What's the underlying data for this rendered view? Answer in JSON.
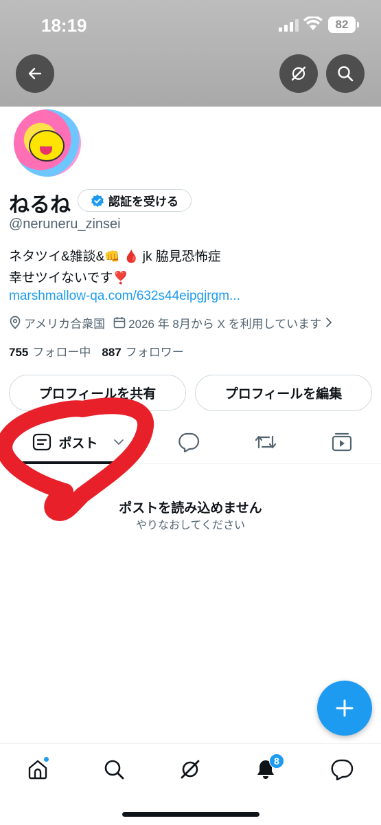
{
  "status_bar": {
    "time": "18:19",
    "battery": "82"
  },
  "profile": {
    "name": "ねるね",
    "verify_label": "認証を受ける",
    "handle": "@neruneru_zinsei",
    "bio_line1_a": "ネタツイ&雑談&",
    "bio_line1_b": "jk 脇見恐怖症",
    "bio_line2": "幸せツイないです",
    "bio_emojis": [
      "👊",
      "🩸",
      "❣️"
    ],
    "link": "marshmallow-qa.com/632s44eipgjrgm...",
    "location": "アメリカ合衆国",
    "joined": "2026 年 8月から X を利用しています",
    "following_count": "755",
    "following_label": "フォロー中",
    "followers_count": "887",
    "followers_label": "フォロワー"
  },
  "actions": {
    "share_label": "プロフィールを共有",
    "edit_label": "プロフィールを編集"
  },
  "tabs": {
    "posts_label": "ポスト"
  },
  "feed": {
    "error_title": "ポストを読み込めません",
    "error_subtitle": "やりなおしてください"
  },
  "nav": {
    "notification_count": "8"
  },
  "colors": {
    "accent": "#1d9bf0",
    "annotation": "#e8202a",
    "banner": "#b3b3b3"
  },
  "icons": [
    "back-arrow-icon",
    "grok-icon",
    "search-icon",
    "verified-badge-icon",
    "location-pin-icon",
    "calendar-icon",
    "chevron-right-icon",
    "posts-icon",
    "chevron-down-icon",
    "reply-icon",
    "repost-icon",
    "media-icon",
    "plus-icon",
    "home-icon",
    "bell-icon",
    "messages-icon"
  ]
}
